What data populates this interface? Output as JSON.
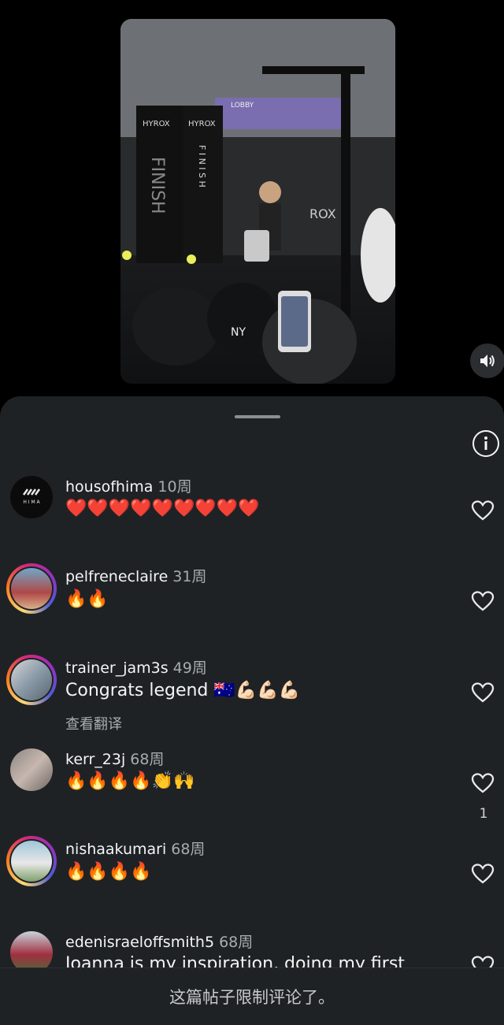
{
  "video": {
    "overlay_texts": [
      "HYROX",
      "FINISH",
      "HYROX",
      "F I N I S H",
      "LOBBY",
      "ROX"
    ]
  },
  "comments": [
    {
      "username": "housofhima",
      "time": "10周",
      "text": "❤️❤️❤️❤️❤️❤️❤️❤️❤️",
      "avatar_label": "H I M A"
    },
    {
      "username": "pelfreneclaire",
      "time": "31周",
      "text": "🔥🔥"
    },
    {
      "username": "trainer_jam3s",
      "time": "49周",
      "text": "Congrats legend 🇦🇺💪🏻💪🏻💪🏻",
      "translate": "查看翻译"
    },
    {
      "username": "kerr_23j",
      "time": "68周",
      "text": "🔥🔥🔥🔥👏🙌",
      "likes": "1"
    },
    {
      "username": "nishaakumari",
      "time": "68周",
      "text": "🔥🔥🔥🔥"
    },
    {
      "username": "edenisraeloffsmith5",
      "time": "68周",
      "text": "Joanna is my inspiration, doing my first"
    }
  ],
  "footer": {
    "text": "这篇帖子限制评论了。"
  },
  "icons": {
    "mute": "speaker-icon",
    "info": "info-icon",
    "like": "heart-icon"
  }
}
